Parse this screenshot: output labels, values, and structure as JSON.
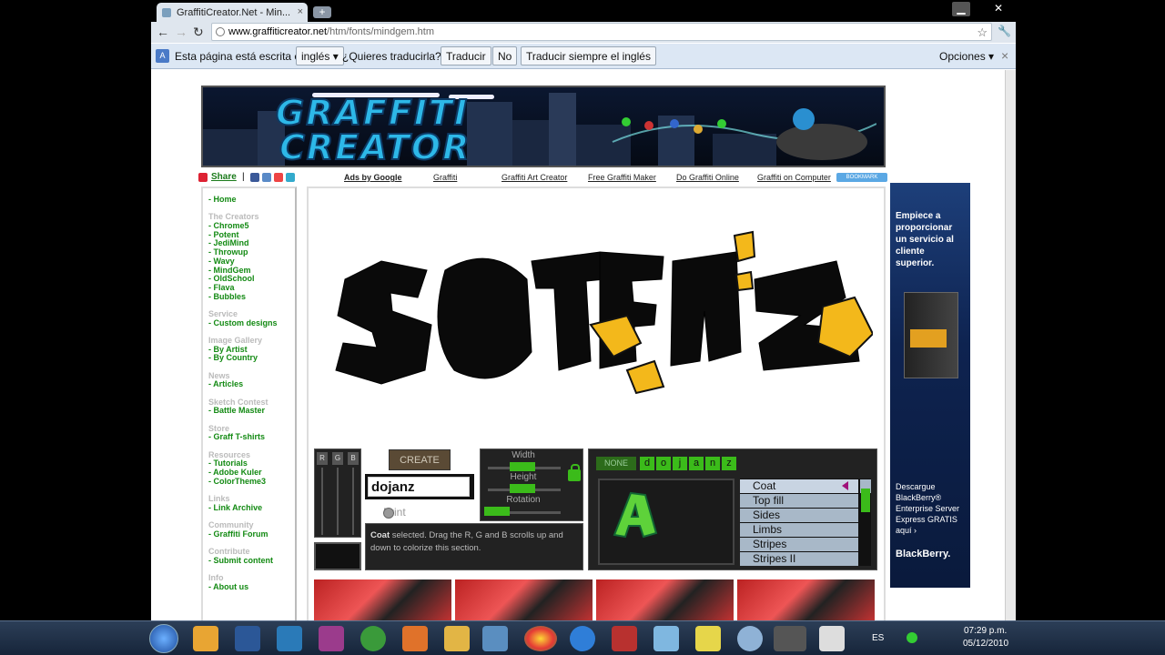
{
  "browser": {
    "tab_title": "GraffitiCreator.Net - Min...",
    "tab_close": "×",
    "new_tab": "+",
    "url_host": "www.graffiticreator.net",
    "url_path": "/htm/fonts/mindgem.htm",
    "star": "☆",
    "wrench": "🔧",
    "back": "←",
    "forward": "→",
    "reload": "↻",
    "minimize": "▁",
    "close": "✕"
  },
  "translate_bar": {
    "text_before": "Esta página está escrita en",
    "language": "inglés",
    "question": "¿Quieres traducirla?",
    "translate_btn": "Traducir",
    "no_btn": "No",
    "always_btn": "Traducir siempre el inglés",
    "options": "Opciones",
    "close": "×"
  },
  "banner": {
    "logo_line1": "GRAFFITI",
    "logo_line2": "CREATOR"
  },
  "linkbar": {
    "share": "Share",
    "separator": "|",
    "links": [
      "Ads by Google",
      "Graffiti",
      "Graffiti Art Creator",
      "Free Graffiti Maker",
      "Do Graffiti Online",
      "Graffiti on Computer"
    ],
    "bookmark": "BOOKMARK"
  },
  "sidebar": {
    "home": "- Home",
    "sections": [
      {
        "title": "The Creators",
        "links": [
          "- Chrome5",
          "- Potent",
          "- JediMind",
          "- Throwup",
          "- Wavy",
          "- MindGem",
          "- OldSchool",
          "- Flava",
          "- Bubbles"
        ]
      },
      {
        "title": "Service",
        "links": [
          "- Custom designs"
        ]
      },
      {
        "title": "Image Gallery",
        "links": [
          "- By Artist",
          "- By Country"
        ]
      },
      {
        "title": "News",
        "links": [
          "- Articles"
        ]
      },
      {
        "title": "Sketch Contest",
        "links": [
          "- Battle Master"
        ]
      },
      {
        "title": "Store",
        "links": [
          "- Graff T-shirts"
        ]
      },
      {
        "title": "Resources",
        "links": [
          "- Tutorials",
          "- Adobe Kuler",
          "- ColorTheme3"
        ]
      },
      {
        "title": "Links",
        "links": [
          "- Link Archive"
        ]
      },
      {
        "title": "Community",
        "links": [
          "- Graffiti Forum"
        ]
      },
      {
        "title": "Contribute",
        "links": [
          "- Submit content"
        ]
      },
      {
        "title": "Info",
        "links": [
          "- About us"
        ]
      }
    ]
  },
  "creator": {
    "rgb_labels": [
      "R",
      "G",
      "B"
    ],
    "create_btn": "CREATE",
    "text_value": "dojanz",
    "print_label": "Print",
    "help_bold": "Coat",
    "help_text": " selected. Drag the R, G and B scrolls up and down to colorize this section.",
    "width_label": "Width",
    "height_label": "Height",
    "rotation_label": "Rotation",
    "none_btn": "NONE",
    "letters": [
      "d",
      "o",
      "j",
      "a",
      "n",
      "z"
    ],
    "parts": [
      "Coat",
      "Top fill",
      "Sides",
      "Limbs",
      "Stripes",
      "Stripes II"
    ],
    "colors": {
      "accent_green": "#3bbb1a",
      "coat_black": "#111111",
      "limb_yellow": "#f3b81b"
    }
  },
  "ad": {
    "headline": "Empiece a proporcionar un servicio al cliente superior.",
    "bottom": "Descargue BlackBerry® Enterprise Server Express GRATIS aquí ›",
    "brand": "BlackBerry."
  },
  "taskbar": {
    "lang": "ES",
    "time": "07:29 p.m.",
    "date": "05/12/2010"
  }
}
